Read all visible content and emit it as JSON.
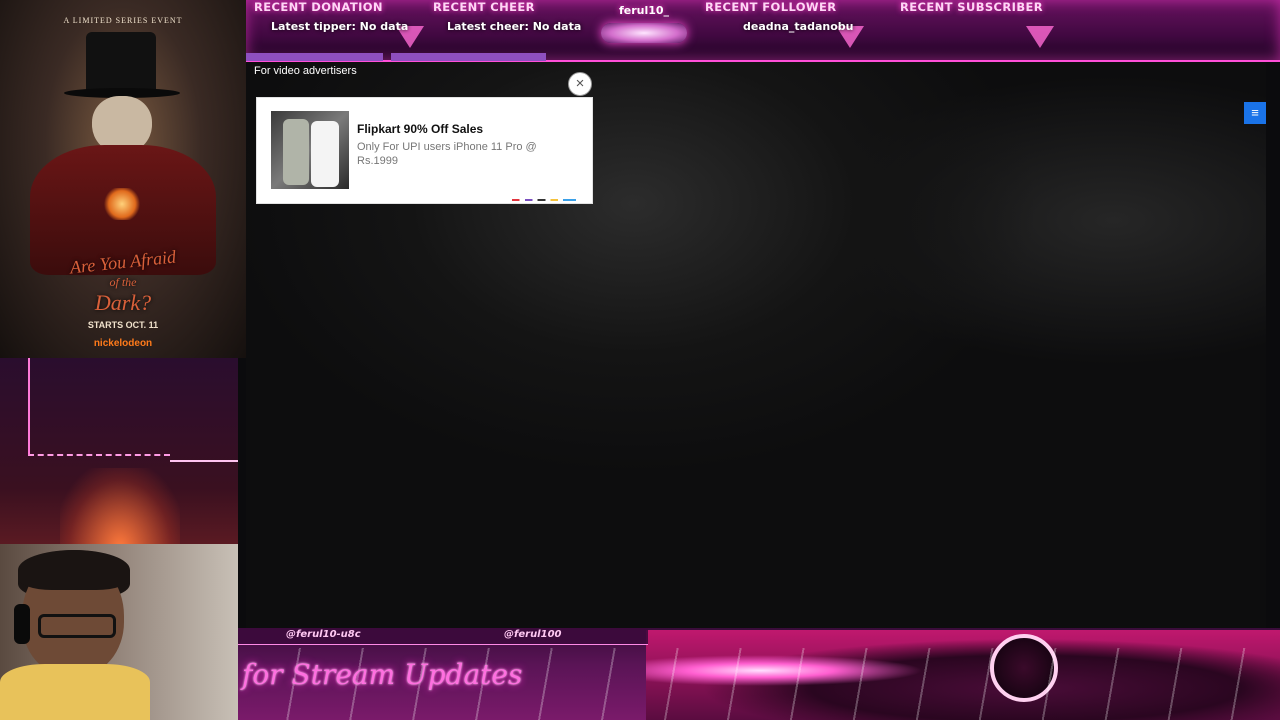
{
  "overlay_top": {
    "recent_donation": {
      "title": "RECENT DONATION",
      "value": "Latest tipper: No data"
    },
    "recent_cheer": {
      "title": "RECENT CHEER",
      "value": "Latest cheer: No data"
    },
    "center_name": "ferul10_",
    "recent_follower": {
      "title": "RECENT FOLLOWER",
      "value": "deadna_tadanobu"
    },
    "recent_subscriber": {
      "title": "RECENT SUBSCRIBER"
    }
  },
  "poster": {
    "tagline": "A LIMITED SERIES EVENT",
    "title_line1": "Are You Afraid",
    "title_line2": "of the",
    "title_line3": "Dark?",
    "starts": "STARTS OCT. 11",
    "network": "nickelodeon"
  },
  "ad": {
    "label": "For video advertisers",
    "title": "Flipkart 90% Off Sales",
    "body": "Only For UPI users iPhone 11 Pro @ Rs.1999",
    "close_icon": "×",
    "menu_icon": "≡"
  },
  "overlay_bottom": {
    "handle_left": "@ferul10-u8c",
    "handle_right": "@ferul100",
    "follow_text": "for Stream Updates"
  },
  "colors": {
    "accent_pink": "#ff4fd8",
    "ad_menu_blue": "#1a73e8",
    "progress_purple": "#8e4fbf"
  }
}
